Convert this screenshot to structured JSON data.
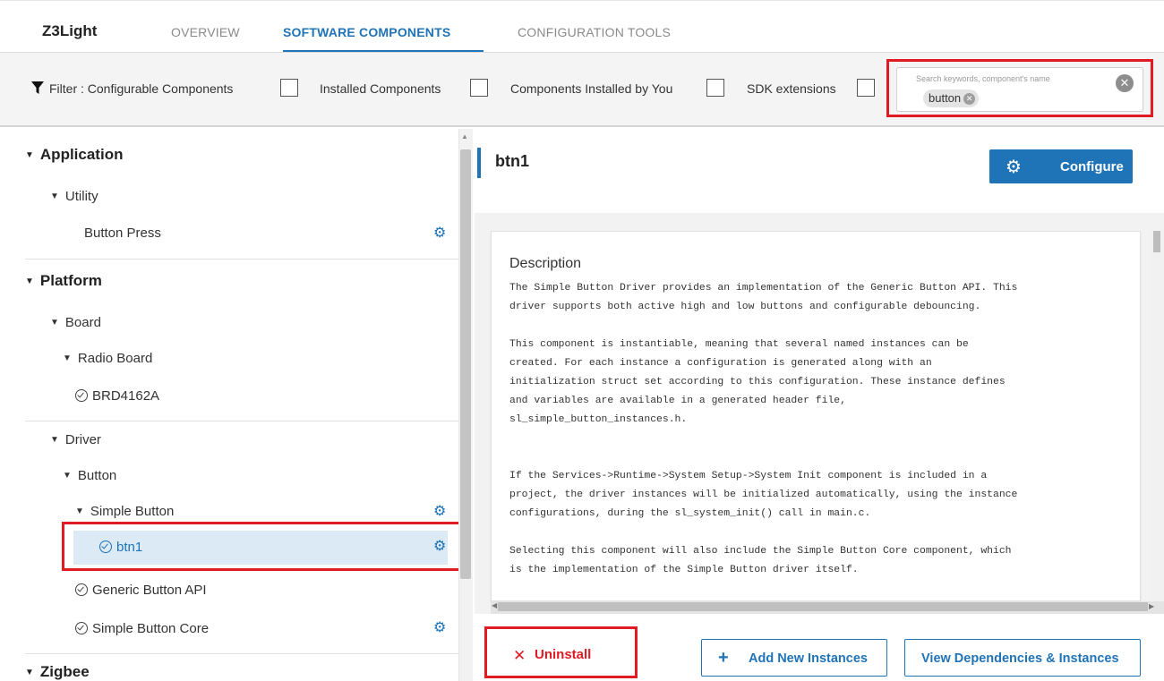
{
  "app": {
    "title": "Z3Light"
  },
  "tabs": [
    {
      "label": "OVERVIEW",
      "active": false
    },
    {
      "label": "SOFTWARE COMPONENTS",
      "active": true
    },
    {
      "label": "CONFIGURATION TOOLS",
      "active": false
    }
  ],
  "filter": {
    "prefix": "Filter :",
    "options": [
      {
        "label": "Configurable Components",
        "checked": false
      },
      {
        "label": "Installed Components",
        "checked": false
      },
      {
        "label": "Components Installed by You",
        "checked": false
      },
      {
        "label": "SDK extensions",
        "checked": false
      }
    ],
    "search": {
      "placeholder": "Search keywords, component's name",
      "chip": "button"
    }
  },
  "tree": {
    "application": "Application",
    "utility": "Utility",
    "button_press": "Button Press",
    "platform": "Platform",
    "board": "Board",
    "radio_board": "Radio Board",
    "brd": "BRD4162A",
    "driver": "Driver",
    "button": "Button",
    "simple_button": "Simple Button",
    "btn1": "btn1",
    "generic_api": "Generic Button API",
    "simple_core": "Simple Button Core",
    "zigbee": "Zigbee"
  },
  "detail": {
    "title": "btn1",
    "configure_label": "Configure",
    "description_heading": "Description",
    "description": [
      "The Simple Button Driver provides an implementation of the Generic Button API. This\ndriver supports both active high and low buttons and configurable debouncing.",
      "This component is instantiable, meaning that several named instances can be\ncreated. For each instance a configuration is generated along with an\ninitialization struct set according to this configuration. These instance defines\nand variables are available in a generated header file,\nsl_simple_button_instances.h.",
      "If the Services->Runtime->System Setup->System Init component is included in a\nproject, the driver instances will be initialized automatically, using the instance\nconfigurations, during the sl_system_init() call in main.c.",
      "Selecting this component will also include the Simple Button Core component, which\nis the implementation of the Simple Button driver itself."
    ],
    "uninstall_label": "Uninstall",
    "add_instances_label": "Add New Instances",
    "dependencies_label": "View Dependencies & Instances"
  },
  "colors": {
    "accent": "#1f73b7",
    "highlight_box": "#e01b24",
    "selected_row": "#dbeaf5"
  }
}
